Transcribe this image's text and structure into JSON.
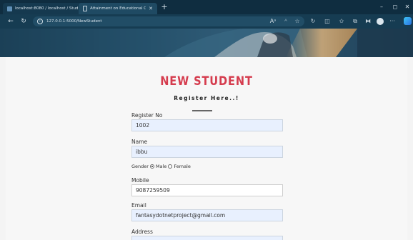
{
  "browser": {
    "tabs": [
      {
        "label": "localhost:8080 / localhost / Stud",
        "active": true
      },
      {
        "label": "Attainment on Educational Cat...",
        "active": false
      }
    ],
    "url": "127.0.0.1:5000/NewStudent"
  },
  "page": {
    "title": "NEW STUDENT",
    "subtitle": "Register Here..!"
  },
  "form": {
    "register_no": {
      "label": "Register No",
      "value": "1002"
    },
    "name": {
      "label": "Name",
      "value": "ibbu"
    },
    "gender": {
      "label": "Gender",
      "options": [
        "Male",
        "Female"
      ],
      "selected": "Male"
    },
    "mobile": {
      "label": "Mobile",
      "value": "9087259509"
    },
    "email": {
      "label": "Email",
      "value": "fantasydotnetproject@gmail.com"
    },
    "address": {
      "label": "Address",
      "value": ""
    }
  },
  "colors": {
    "title": "#d53c4e",
    "autofill": "#e8f0fe",
    "tabstrip": "#0f2d40"
  }
}
